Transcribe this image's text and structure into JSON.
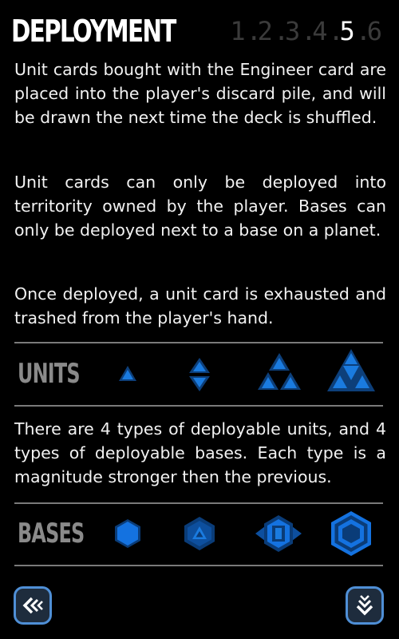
{
  "header": {
    "title": "DEPLOYMENT",
    "pages": [
      "1",
      "2",
      "3",
      "4",
      "5",
      "6"
    ],
    "current_page": "5"
  },
  "paragraphs": [
    "Unit cards bought with the Engineer card are placed into the player's discard pile, and will be drawn the next time the deck is shuffled.",
    "Unit cards can only be deployed into territority owned by the player. Bases can only be deployed next to a base on a planet.",
    "Once deployed, a unit card is exhausted and trashed from the player's hand.",
    "There are 4 types of deployable units, and 4 types of deployable bases. Each type is a magnitude stronger then the previous."
  ],
  "units": {
    "label": "UNITS",
    "icons": [
      "unit-tier-1-icon",
      "unit-tier-2-icon",
      "unit-tier-3-icon",
      "unit-tier-4-icon"
    ]
  },
  "bases": {
    "label": "BASES",
    "icons": [
      "base-tier-1-icon",
      "base-tier-2-icon",
      "base-tier-3-icon",
      "base-tier-4-icon"
    ]
  },
  "nav": {
    "back_icon": "double-chevron-left-icon",
    "next_icon": "double-chevron-down-icon"
  },
  "colors": {
    "background": "#000000",
    "icon_blue": "#0f6fd8",
    "icon_dark_blue": "#0d3f7a",
    "button_border": "#4f8fd6",
    "button_fill": "#1e2c3d",
    "divider": "#7a7a7a",
    "page_inactive": "#3b3b3b",
    "page_active": "#ffffff"
  }
}
